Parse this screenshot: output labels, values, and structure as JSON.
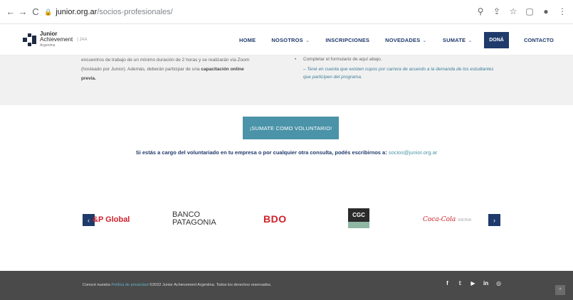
{
  "browser": {
    "back_icon": "←",
    "forward_icon": "→",
    "reload_icon": "C",
    "lock_icon": "🔒",
    "url_host": "junior.org.ar",
    "url_path": "/socios-profesionales/",
    "icons": [
      "search-icon",
      "share-icon",
      "star-icon",
      "tab-icon",
      "profile-icon",
      "menu-icon"
    ],
    "icon_glyphs": [
      "⚲",
      "⇪",
      "☆",
      "▢",
      "●",
      "⋮"
    ]
  },
  "header": {
    "logo_line1": "Junior",
    "logo_line2": "Achievement",
    "logo_line3": "Argentina",
    "logo_sep": "| JAA",
    "nav": [
      {
        "label": "HOME",
        "chevron": ""
      },
      {
        "label": "NOSOTROS",
        "chevron": "⌄"
      },
      {
        "label": "INSCRIPCIONES",
        "chevron": ""
      },
      {
        "label": "NOVEDADES",
        "chevron": "⌄"
      },
      {
        "label": "SUMATE",
        "chevron": "⌄"
      }
    ],
    "dona_label": "DONÁ",
    "contacto_label": "CONTACTO"
  },
  "info": {
    "left_line1": "encuentros de trabajo de un mínimo duración de 2 horas y se realizarán vía Zoom",
    "left_line2": "(hosteado por Junior). Además, deberán participar de una",
    "left_bold": "capacitación online",
    "left_line3": "previa.",
    "right_bullet": "•",
    "right_item": "Completar el formulario de aquí abajo.",
    "right_note": "– Tené en cuenta que existen cupos por carrera de acuerdo a la demanda de los estudiantes que participen del programa."
  },
  "cta": {
    "label": "¡SUMATE COMO VOLUNTARIO!"
  },
  "contact": {
    "text": "Si estás a cargo del voluntariado en tu empresa o por cualquier otra consulta, podés escribirnos a:",
    "email": "socios@junior.org.ar"
  },
  "sponsors": {
    "prev_icon": "‹",
    "next_icon": "›",
    "sp_label": "&P Global",
    "bp_line1": "BANCO",
    "bp_line2": "PATAGONIA",
    "bdo_label": "BDO",
    "cgc_label": "CGC",
    "coca_label": "Coca-Cola",
    "coca_sub": "ANDINA"
  },
  "footer": {
    "text_prefix": "Conocé nuestra",
    "link_text": "Política de privacidad",
    "text_suffix": "©2022 Junior Achievement Argentina. Todos los derechos reservados.",
    "socials": [
      "f",
      "𝕥",
      "▶",
      "in",
      "◎"
    ],
    "back_top_icon": "^"
  }
}
